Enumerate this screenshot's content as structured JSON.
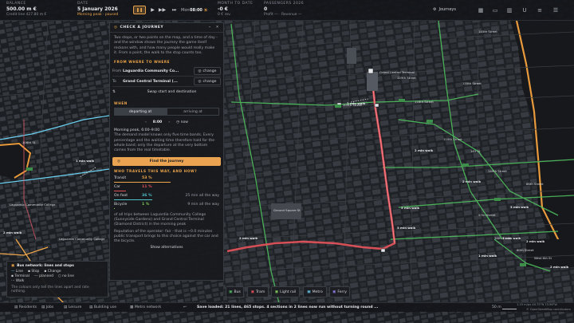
{
  "topbar": {
    "balance_label": "BALANCE",
    "balance_value": "500.00 m €",
    "credit_line": "Credit line 427.80 m €",
    "date_label": "DATE",
    "date_value": "5 January 2026",
    "period_text": "Morning peak",
    "paused_text": "· paused",
    "day": "Mon",
    "time": "08:00",
    "pause_icon": "pause-icon",
    "month_label": "MONTH TO DATE",
    "month_value": "-0 €",
    "month_sub": "0 € rev.",
    "passengers_label": "PASSENGERS 2026",
    "passengers_value": "0",
    "passengers_sub": "Profit — · Revenue —",
    "journeys_label": "Journeys"
  },
  "panel": {
    "title": "CHECK A JOURNEY",
    "intro": "Two stops, or two points on the map, and a time of day - and the window shows the journey the game itself reckons with, and how many people would really make it. From a point, the walk to the stop counts too.",
    "from_to_label": "FROM WHERE TO WHERE",
    "from_key": "From",
    "from_value": "Laguardia Community Co...",
    "to_key": "To",
    "to_value": "Grand Central Terminal (...",
    "change_label": "change",
    "swap_label": "Swap start and destination",
    "when_label": "WHEN",
    "departing_label": "departing at",
    "arriving_label": "arriving at",
    "time_value": "8:00",
    "now_label": "now",
    "period_line": "Morning peak, 6:00–9:00",
    "demand_text": "The demand model knows only five time bands. Every percentage and the waiting time therefore hold for the whole band; only the departure at the very bottom comes from the real timetable.",
    "find_button": "Find the journey",
    "who_label": "WHO TRAVELS THIS WAY, AND HOW?",
    "modes": [
      {
        "name": "Transit",
        "pct": "53 %",
        "share": 53,
        "color": "#f0a64a",
        "right": ""
      },
      {
        "name": "Car",
        "pct": "11 %",
        "share": 11,
        "color": "#e0525a",
        "right": ""
      },
      {
        "name": "On foot",
        "pct": "36 %",
        "share": 36,
        "color": "#4fc3c9",
        "right": "25 min all the way"
      },
      {
        "name": "Bicycle",
        "pct": "1 %",
        "share": 1,
        "color": "#7fc95a",
        "right": "9 min all the way"
      }
    ],
    "trips_text": "of all trips between Laguardia Community College (Sunnyside Gardens) and Grand Central Terminal (Diamond District) in the morning peak",
    "reputation_text": "Reputation of the operator: fair - that is ~0.0 minutes public transport brings to this choice against the car and the bicycle.",
    "alternatives_label": "Show alternatives"
  },
  "legend": {
    "title": "Bus network: lines and stops",
    "line_label": "Line",
    "stop_label": "Stop",
    "change_label": "Change",
    "terminal_label": "Terminal",
    "planned_label": "planned",
    "noline_label": "no line",
    "walk_label": "Walk",
    "note": "The colours only tell the lines apart and rate nothing."
  },
  "transit_buttons": [
    "Bus",
    "Tram",
    "Light rail",
    "Metro",
    "Ferry"
  ],
  "bottombar": {
    "residents": "Residents",
    "jobs": "Jobs",
    "leisure": "Leisure",
    "building_use": "Building use",
    "metro_network": "Metro network",
    "status": "Save loaded: 21 lines, 465 stops. 4 sections in 2 lines now run without turning round ...",
    "scale": "50 m",
    "coords": "1.25 m/px  40.75°N 73.98°W",
    "attribution": "© OpenStreetMap contributors"
  },
  "map_labels": {
    "gct": "Grand Central Terminal",
    "lgcc1": "Laguardia Community College",
    "lgcc2": "Laguardia Community College",
    "st_108": "108th St",
    "st_125": "125th Street",
    "st_135": "135th Street",
    "st_116": "116th Street",
    "st_145": "145th Street",
    "st_103": "103rd Street",
    "st_110": "110th Street",
    "st_161": "161 St",
    "st_149": "149th Street",
    "st_86": "86th Street",
    "st_57": "57th Street",
    "st_34": "34th Street",
    "st_60": "60th Street",
    "square_st": "Ground Square St",
    "west_st": "West 6th St",
    "walk_labels": [
      "2 min walk",
      "2 min walk",
      "1 min walk",
      "5 min walk",
      "2 min walk",
      "2 min walk",
      "2 min walk",
      "1 min walk",
      "3 min walk",
      "2 min walk",
      "3 min walk",
      "1 min walk",
      "2 min walk"
    ]
  }
}
